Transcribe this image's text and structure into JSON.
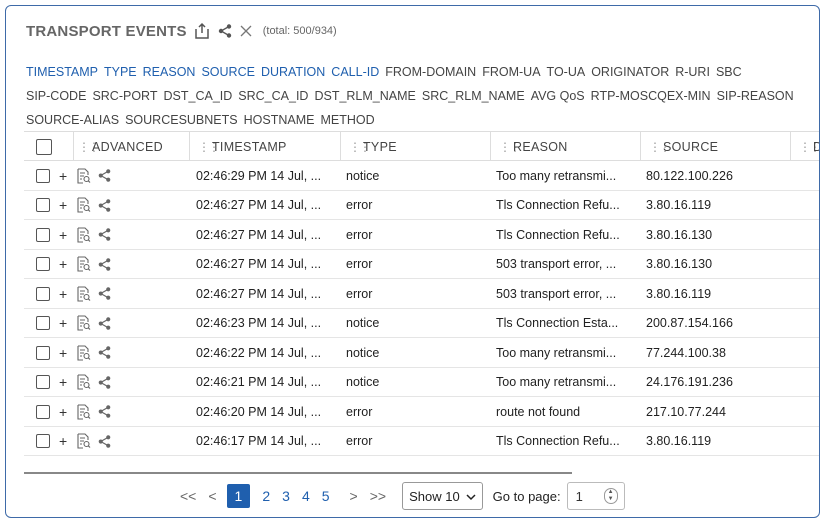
{
  "header": {
    "title": "TRANSPORT EVENTS",
    "total": "(total: 500/934)"
  },
  "fields": {
    "selected": [
      "TIMESTAMP",
      "TYPE",
      "REASON",
      "SOURCE",
      "DURATION",
      "CALL-ID"
    ],
    "available": [
      "FROM-DOMAIN",
      "FROM-UA",
      "TO-UA",
      "ORIGINATOR",
      "R-URI",
      "SBC",
      "SIP-CODE",
      "SRC-PORT",
      "DST_CA_ID",
      "SRC_CA_ID",
      "DST_RLM_NAME",
      "SRC_RLM_NAME",
      "AVG QoS",
      "RTP-MOSCQEX-MIN",
      "SIP-REASON",
      "SOURCE-ALIAS",
      "SOURCESUBNETS",
      "HOSTNAME",
      "METHOD"
    ]
  },
  "table": {
    "columns": {
      "advanced": "ADVANCED",
      "timestamp": "TIMESTAMP",
      "type": "TYPE",
      "reason": "REASON",
      "source": "SOURCE",
      "next": "D"
    },
    "rows": [
      {
        "timestamp": "02:46:29 PM 14 Jul, ...",
        "type": "notice",
        "reason": "Too many retransmi...",
        "source": "80.122.100.226"
      },
      {
        "timestamp": "02:46:27 PM 14 Jul, ...",
        "type": "error",
        "reason": "Tls Connection Refu...",
        "source": "3.80.16.119"
      },
      {
        "timestamp": "02:46:27 PM 14 Jul, ...",
        "type": "error",
        "reason": "Tls Connection Refu...",
        "source": "3.80.16.130"
      },
      {
        "timestamp": "02:46:27 PM 14 Jul, ...",
        "type": "error",
        "reason": "503 transport error, ...",
        "source": "3.80.16.130"
      },
      {
        "timestamp": "02:46:27 PM 14 Jul, ...",
        "type": "error",
        "reason": "503 transport error, ...",
        "source": "3.80.16.119"
      },
      {
        "timestamp": "02:46:23 PM 14 Jul, ...",
        "type": "notice",
        "reason": "Tls Connection Esta...",
        "source": "200.87.154.166"
      },
      {
        "timestamp": "02:46:22 PM 14 Jul, ...",
        "type": "notice",
        "reason": "Too many retransmi...",
        "source": "77.244.100.38"
      },
      {
        "timestamp": "02:46:21 PM 14 Jul, ...",
        "type": "notice",
        "reason": "Too many retransmi...",
        "source": "24.176.191.236"
      },
      {
        "timestamp": "02:46:20 PM 14 Jul, ...",
        "type": "error",
        "reason": "route not found",
        "source": "217.10.77.244"
      },
      {
        "timestamp": "02:46:17 PM 14 Jul, ...",
        "type": "error",
        "reason": "Tls Connection Refu...",
        "source": "3.80.16.119"
      }
    ],
    "expand_symbol": "+"
  },
  "pagination": {
    "first": "<<",
    "prev": "<",
    "pages": [
      "1",
      "2",
      "3",
      "4",
      "5"
    ],
    "active_page": "1",
    "next": ">",
    "last": ">>",
    "page_size": "Show 10",
    "goto_label": "Go to page:",
    "goto_value": "1"
  },
  "colors": {
    "accent": "#1f5fae",
    "border": "#3e6aa8"
  },
  "icons": [
    "export-icon",
    "share-icon",
    "close-icon",
    "grip-icon",
    "details-icon",
    "chevron-down-icon",
    "spinner-icon"
  ]
}
